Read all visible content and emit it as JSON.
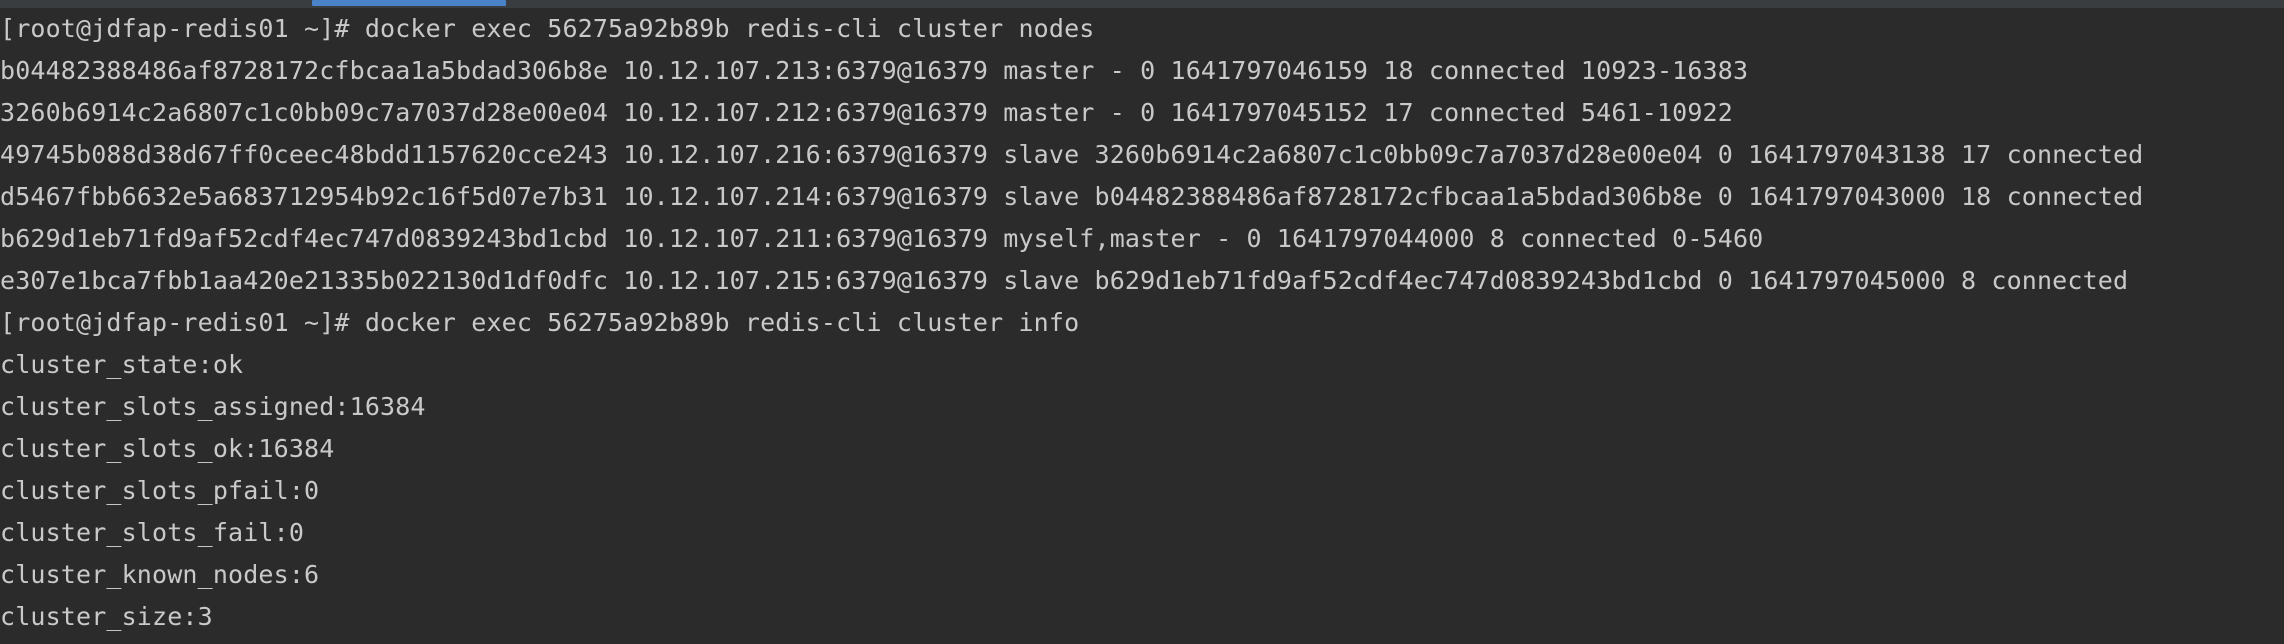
{
  "terminal": {
    "lines": [
      "[root@jdfap-redis01 ~]# docker exec 56275a92b89b redis-cli cluster nodes",
      "b04482388486af8728172cfbcaa1a5bdad306b8e 10.12.107.213:6379@16379 master - 0 1641797046159 18 connected 10923-16383",
      "3260b6914c2a6807c1c0bb09c7a7037d28e00e04 10.12.107.212:6379@16379 master - 0 1641797045152 17 connected 5461-10922",
      "49745b088d38d67ff0ceec48bdd1157620cce243 10.12.107.216:6379@16379 slave 3260b6914c2a6807c1c0bb09c7a7037d28e00e04 0 1641797043138 17 connected",
      "d5467fbb6632e5a683712954b92c16f5d07e7b31 10.12.107.214:6379@16379 slave b04482388486af8728172cfbcaa1a5bdad306b8e 0 1641797043000 18 connected",
      "b629d1eb71fd9af52cdf4ec747d0839243bd1cbd 10.12.107.211:6379@16379 myself,master - 0 1641797044000 8 connected 0-5460",
      "e307e1bca7fbb1aa420e21335b022130d1df0dfc 10.12.107.215:6379@16379 slave b629d1eb71fd9af52cdf4ec747d0839243bd1cbd 0 1641797045000 8 connected",
      "[root@jdfap-redis01 ~]# docker exec 56275a92b89b redis-cli cluster info",
      "cluster_state:ok",
      "cluster_slots_assigned:16384",
      "cluster_slots_ok:16384",
      "cluster_slots_pfail:0",
      "cluster_slots_fail:0",
      "cluster_known_nodes:6",
      "cluster_size:3"
    ]
  },
  "colors": {
    "background": "#2b2b2b",
    "text": "#c9c9c9",
    "scrollbar_thumb": "#4b83c9"
  }
}
